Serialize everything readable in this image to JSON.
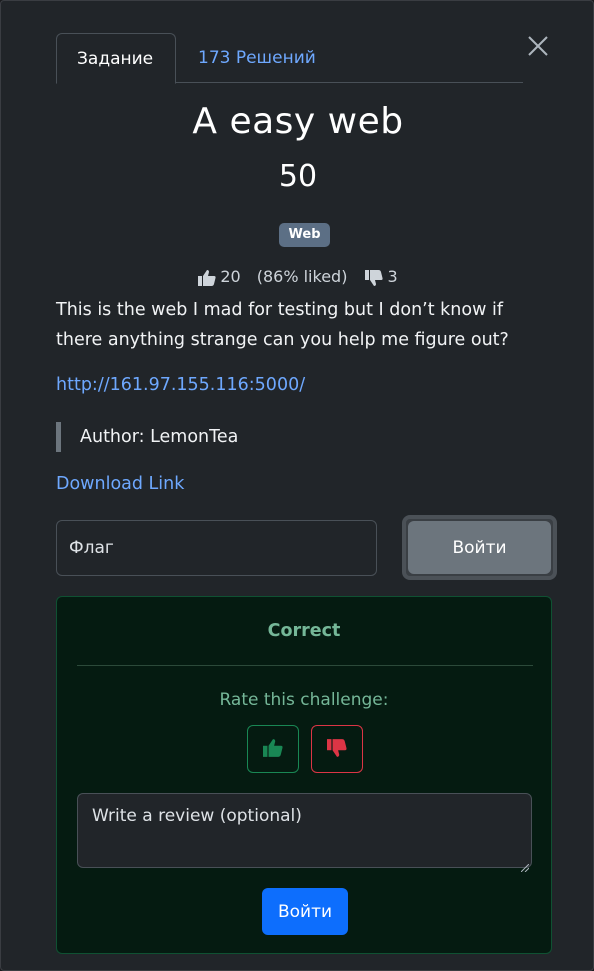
{
  "tabs": [
    {
      "label": "Задание"
    },
    {
      "label": "173 Решений"
    }
  ],
  "challenge": {
    "title": "A easy web",
    "value": "50",
    "category": "Web",
    "likes": "20",
    "liked_percent": "(86% liked)",
    "dislikes": "3",
    "description": "This is the web I mad for testing but I don’t know if there anything strange can you help me figure out?",
    "url": "http://161.97.155.116:5000/",
    "author": "Author: LemonTea",
    "download_label": "Download Link"
  },
  "flag_form": {
    "placeholder": "Флаг",
    "submit_label": "Войти"
  },
  "result": {
    "status": "Correct",
    "rate_label": "Rate this challenge:",
    "review_placeholder": "Write a review (optional)",
    "submit_label": "Войти"
  },
  "icons": {
    "close": "close-icon",
    "like": "thumbs-up-icon",
    "dislike": "thumbs-down-icon"
  },
  "colors": {
    "link": "#6ea8fe",
    "success": "#75b798",
    "danger": "#dc3545",
    "primary": "#0d6efd",
    "badge": "#5c6f85"
  }
}
